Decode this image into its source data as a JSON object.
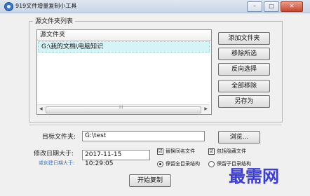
{
  "window": {
    "title": "919文件增量复制小工具",
    "controls": [
      "–",
      "□",
      "✕"
    ]
  },
  "source_group": {
    "label": "源文件夹列表",
    "column_header": "源文件夹",
    "rows": [
      "G:\\我的文档\\电脑知识"
    ],
    "scroll_grip": "III"
  },
  "side_buttons": {
    "add": "添加文件夹",
    "remove": "移除所选",
    "invert": "反向选择",
    "remove_all": "全部移除",
    "save_as": "另存为"
  },
  "target": {
    "label": "目标文件夹:",
    "value": "G:\\test",
    "browse": "浏览..."
  },
  "modified": {
    "label": "修改日期大于:",
    "sub_label": "或创建日期大于:",
    "value": "2017-11-15 10:29:05"
  },
  "options": {
    "replace_same_name": {
      "label": "替换同名文件",
      "checked": true,
      "mark": "☑"
    },
    "include_hidden": {
      "label": "包括隐藏文件",
      "checked": true,
      "mark": "☑"
    },
    "keep_full_structure": {
      "label": "保留全目录结构",
      "selected": true
    },
    "keep_sub_structure": {
      "label": "保留子目录结构",
      "selected": false
    }
  },
  "start_button": "开始复制",
  "watermark": "最需网",
  "accent_color": "#3b7bd0",
  "selection_color": "#d6f3f6"
}
